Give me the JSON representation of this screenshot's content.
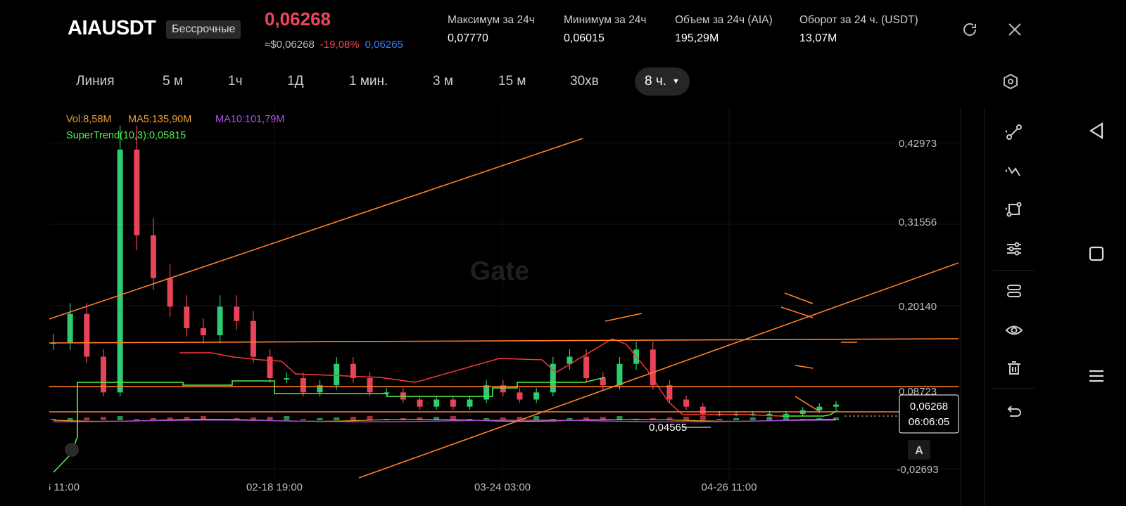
{
  "header": {
    "pair": "AIAUSDT",
    "badge": "Бессрочные",
    "price": "0,06268",
    "approx_usd": "≈$0,06268",
    "change": "-19,08%",
    "mark": "0,06265",
    "stats": [
      {
        "label": "Максимум за 24ч",
        "value": "0,07770"
      },
      {
        "label": "Минимум за 24ч",
        "value": "0,06015"
      },
      {
        "label": "Объем за 24ч (AIA)",
        "value": "195,29M"
      },
      {
        "label": "Оборот за 24 ч. (USDT)",
        "value": "13,07M"
      }
    ]
  },
  "timeframes": [
    "Линия",
    "5 м",
    "1ч",
    "1Д",
    "1 мин.",
    "3 м",
    "15 м",
    "30хв"
  ],
  "active_timeframe": "8 ч.",
  "indicators": {
    "vol": "Vol:8,58M",
    "ma5": "MA5:135,90M",
    "ma10": "MA10:101,79M",
    "supertrend": "SuperTrend(10,3):0,05815"
  },
  "watermark": "Gate",
  "axis": {
    "y_ticks": [
      "0,42973",
      "0,31556",
      "0,20140",
      "0,08723",
      "-0,02693"
    ],
    "x_ticks": [
      "02-18 19:00",
      "03-24 03:00",
      "04-26 11:00"
    ],
    "x_partial": "6 11:00"
  },
  "markers": {
    "low_label": "0,04565",
    "current_price": "0,06268",
    "countdown": "06:06:05",
    "auto_btn": "A"
  },
  "colors": {
    "up": "#2ecc71",
    "down": "#e84358",
    "accent_price": "#f0445c",
    "mark_blue": "#3b82f6",
    "drawing": "#ff7f2a",
    "ma5": "#f0a030",
    "ma10": "#a64ddf",
    "supertrend_up": "#4ef04e",
    "supertrend_down": "#ff3b3b"
  },
  "toolbar_icons": [
    "trend-line-icon",
    "zigzag-icon",
    "rect-tool-icon",
    "indicator-settings-icon",
    "layout-icon",
    "eye-icon",
    "trash-icon",
    "undo-icon"
  ],
  "system_nav": [
    "back-icon",
    "home-icon",
    "menu-icon"
  ],
  "chart_data": {
    "type": "candlestick",
    "y_ticks": [
      0.42973,
      0.31556,
      0.2014,
      0.08723,
      -0.02693
    ],
    "x_ticks": [
      "02-18 19:00",
      "03-24 03:00",
      "04-26 11:00"
    ],
    "last_price": 0.06268,
    "period_low": 0.04565,
    "closes": [
      0.15,
      0.19,
      0.13,
      0.08,
      0.42,
      0.3,
      0.24,
      0.2,
      0.17,
      0.16,
      0.2,
      0.18,
      0.13,
      0.1,
      0.1,
      0.08,
      0.09,
      0.12,
      0.1,
      0.08,
      0.08,
      0.07,
      0.06,
      0.07,
      0.06,
      0.07,
      0.09,
      0.08,
      0.07,
      0.08,
      0.12,
      0.13,
      0.1,
      0.09,
      0.12,
      0.14,
      0.09,
      0.07,
      0.06,
      0.05,
      0.05,
      0.05,
      0.05,
      0.05,
      0.05,
      0.055,
      0.06,
      0.063
    ]
  }
}
